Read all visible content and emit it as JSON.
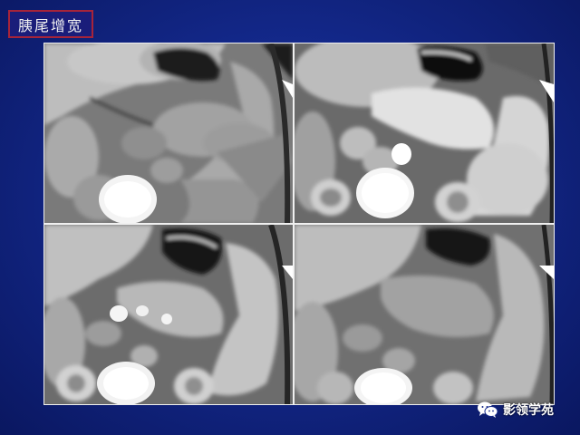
{
  "slide": {
    "title": "胰尾增宽"
  },
  "watermark": {
    "text": "影领学苑",
    "icon": "wechat-icon"
  },
  "panels": [
    {
      "name": "ct-panel-top-left",
      "phase": "unenhanced"
    },
    {
      "name": "ct-panel-top-right",
      "phase": "enhanced"
    },
    {
      "name": "ct-panel-bottom-left",
      "phase": "enhanced"
    },
    {
      "name": "ct-panel-bottom-right",
      "phase": "delayed"
    }
  ],
  "colors": {
    "background": "#13288a",
    "title_border": "#a6243a",
    "title_fill": "#1a1d7a"
  }
}
